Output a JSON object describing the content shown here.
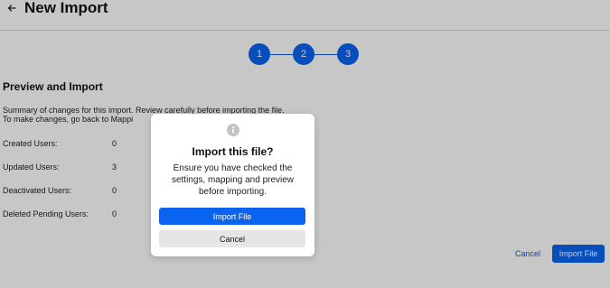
{
  "header": {
    "title": "New Import",
    "back_icon": "arrow-left-icon"
  },
  "stepper": {
    "steps": [
      "1",
      "2",
      "3"
    ],
    "active_color": "#0a64f0"
  },
  "preview": {
    "title": "Preview and Import",
    "summary": "Summary of changes for this import. Review carefully before importing the file. To make changes, go back to Mappi",
    "stats": [
      {
        "label": "Created Users:",
        "value": "0"
      },
      {
        "label": "Updated Users:",
        "value": "3"
      },
      {
        "label": "Deactivated Users:",
        "value": "0"
      },
      {
        "label": "Deleted Pending Users:",
        "value": "0"
      }
    ]
  },
  "footer": {
    "cancel_label": "Cancel",
    "import_label": "Import File"
  },
  "modal": {
    "icon": "info-icon",
    "title": "Import this file?",
    "body": "Ensure you have checked the settings, mapping and preview before importing.",
    "import_label": "Import File",
    "cancel_label": "Cancel"
  },
  "colors": {
    "primary": "#0a64f0",
    "overlay": "rgba(0,0,0,0.22)",
    "secondary_button": "#e6e6e6"
  }
}
